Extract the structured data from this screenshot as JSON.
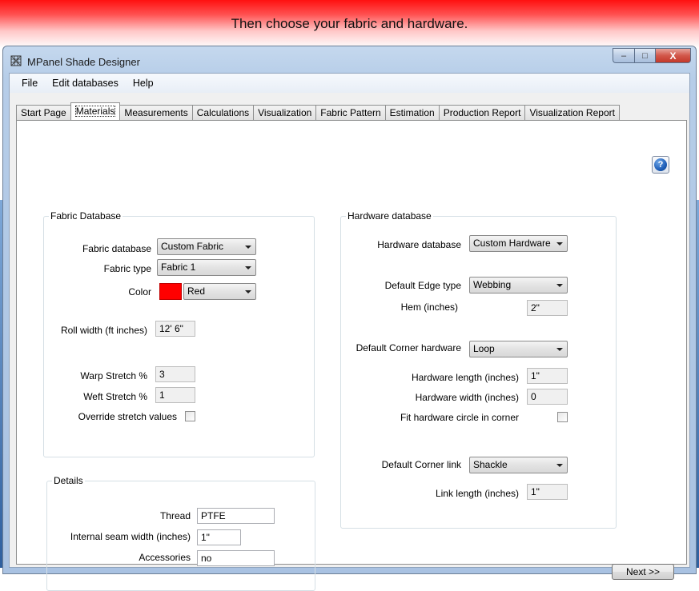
{
  "banner": {
    "text": "Then choose your fabric and hardware."
  },
  "window": {
    "title": "MPanel Shade Designer",
    "app_icon": "grid-icon",
    "controls": {
      "minimize": "–",
      "maximize": "□",
      "close": "X"
    }
  },
  "menu": {
    "items": [
      "File",
      "Edit databases",
      "Help"
    ]
  },
  "tabs": {
    "active": "Materials",
    "items": [
      "Start Page",
      "Materials",
      "Measurements",
      "Calculations",
      "Visualization",
      "Fabric Pattern",
      "Estimation",
      "Production Report",
      "Visualization Report"
    ]
  },
  "help_button": {
    "icon": "help-icon",
    "glyph": "?"
  },
  "fabric": {
    "title": "Fabric Database",
    "database_label": "Fabric database",
    "database_value": "Custom Fabric",
    "type_label": "Fabric type",
    "type_value": "Fabric 1",
    "color_label": "Color",
    "color_value": "Red",
    "color_swatch": "#ff0000",
    "roll_width_label": "Roll width (ft inches)",
    "roll_width_value": "12' 6\"",
    "warp_label": "Warp Stretch %",
    "warp_value": "3",
    "weft_label": "Weft Stretch %",
    "weft_value": "1",
    "override_label": "Override stretch values",
    "override_checked": false
  },
  "details": {
    "title": "Details",
    "thread_label": "Thread",
    "thread_value": "PTFE",
    "seam_label": "Internal seam width (inches)",
    "seam_value": "1\"",
    "accessories_label": "Accessories",
    "accessories_value": "no"
  },
  "hardware": {
    "title": "Hardware database",
    "database_label": "Hardware database",
    "database_value": "Custom Hardware",
    "edge_label": "Default Edge type",
    "edge_value": "Webbing",
    "hem_label": "Hem (inches)",
    "hem_value": "2\"",
    "corner_label": "Default Corner hardware",
    "corner_value": "Loop",
    "length_label": "Hardware length (inches)",
    "length_value": "1\"",
    "width_label": "Hardware width (inches)",
    "width_value": "0",
    "fit_label": "Fit hardware circle in corner",
    "fit_checked": false,
    "link_label": "Default Corner link",
    "link_value": "Shackle",
    "link_length_label": "Link length (inches)",
    "link_length_value": "1\""
  },
  "next_button": "Next >>"
}
